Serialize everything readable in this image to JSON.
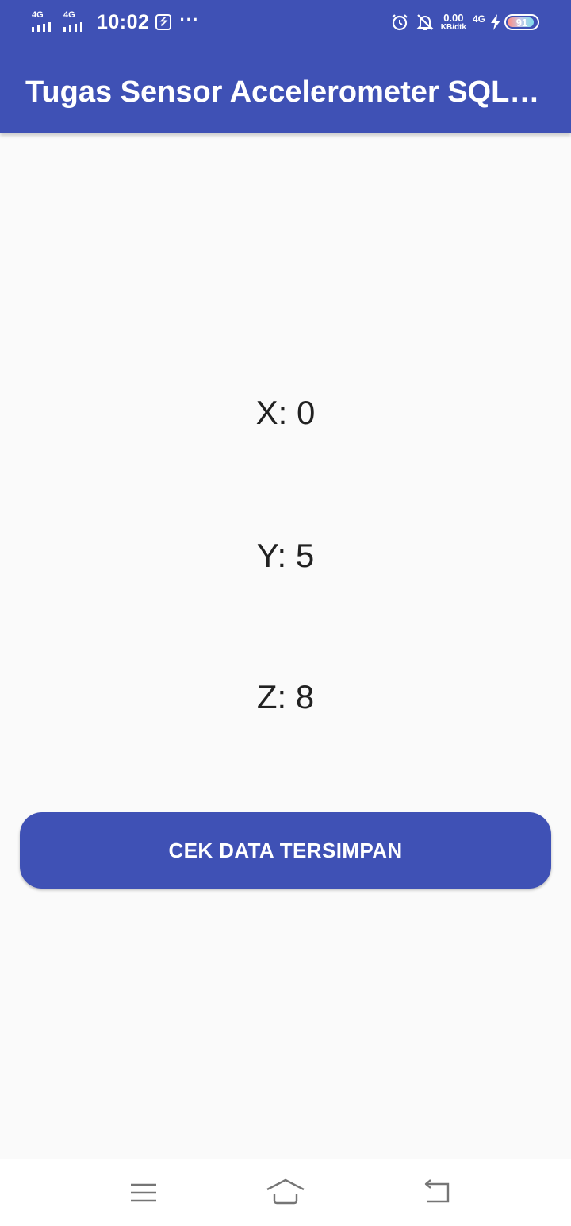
{
  "status_bar": {
    "sim1_network": "4G",
    "sim2_network": "4G",
    "time": "10:02",
    "more_indicator": "···",
    "net_speed_value": "0.00",
    "net_speed_unit": "KB/dtk",
    "data_network": "4G",
    "battery_level": "91",
    "battery_fraction": 0.91,
    "icons": [
      "signal-icon",
      "usb-icon",
      "alarm-icon",
      "bell-muted-icon",
      "charging-bolt-icon",
      "battery-icon"
    ]
  },
  "app_bar": {
    "title": "Tugas Sensor Accelerometer SQLite"
  },
  "readings": {
    "x": "X: 0",
    "y": "Y: 5",
    "z": "Z: 8"
  },
  "actions": {
    "check_saved_label": "CEK DATA TERSIMPAN"
  },
  "nav_bar": {
    "icons": [
      "menu-icon",
      "home-icon",
      "back-icon"
    ]
  },
  "colors": {
    "primary": "#3f51b5",
    "background": "#fafafa",
    "text": "#212121"
  }
}
